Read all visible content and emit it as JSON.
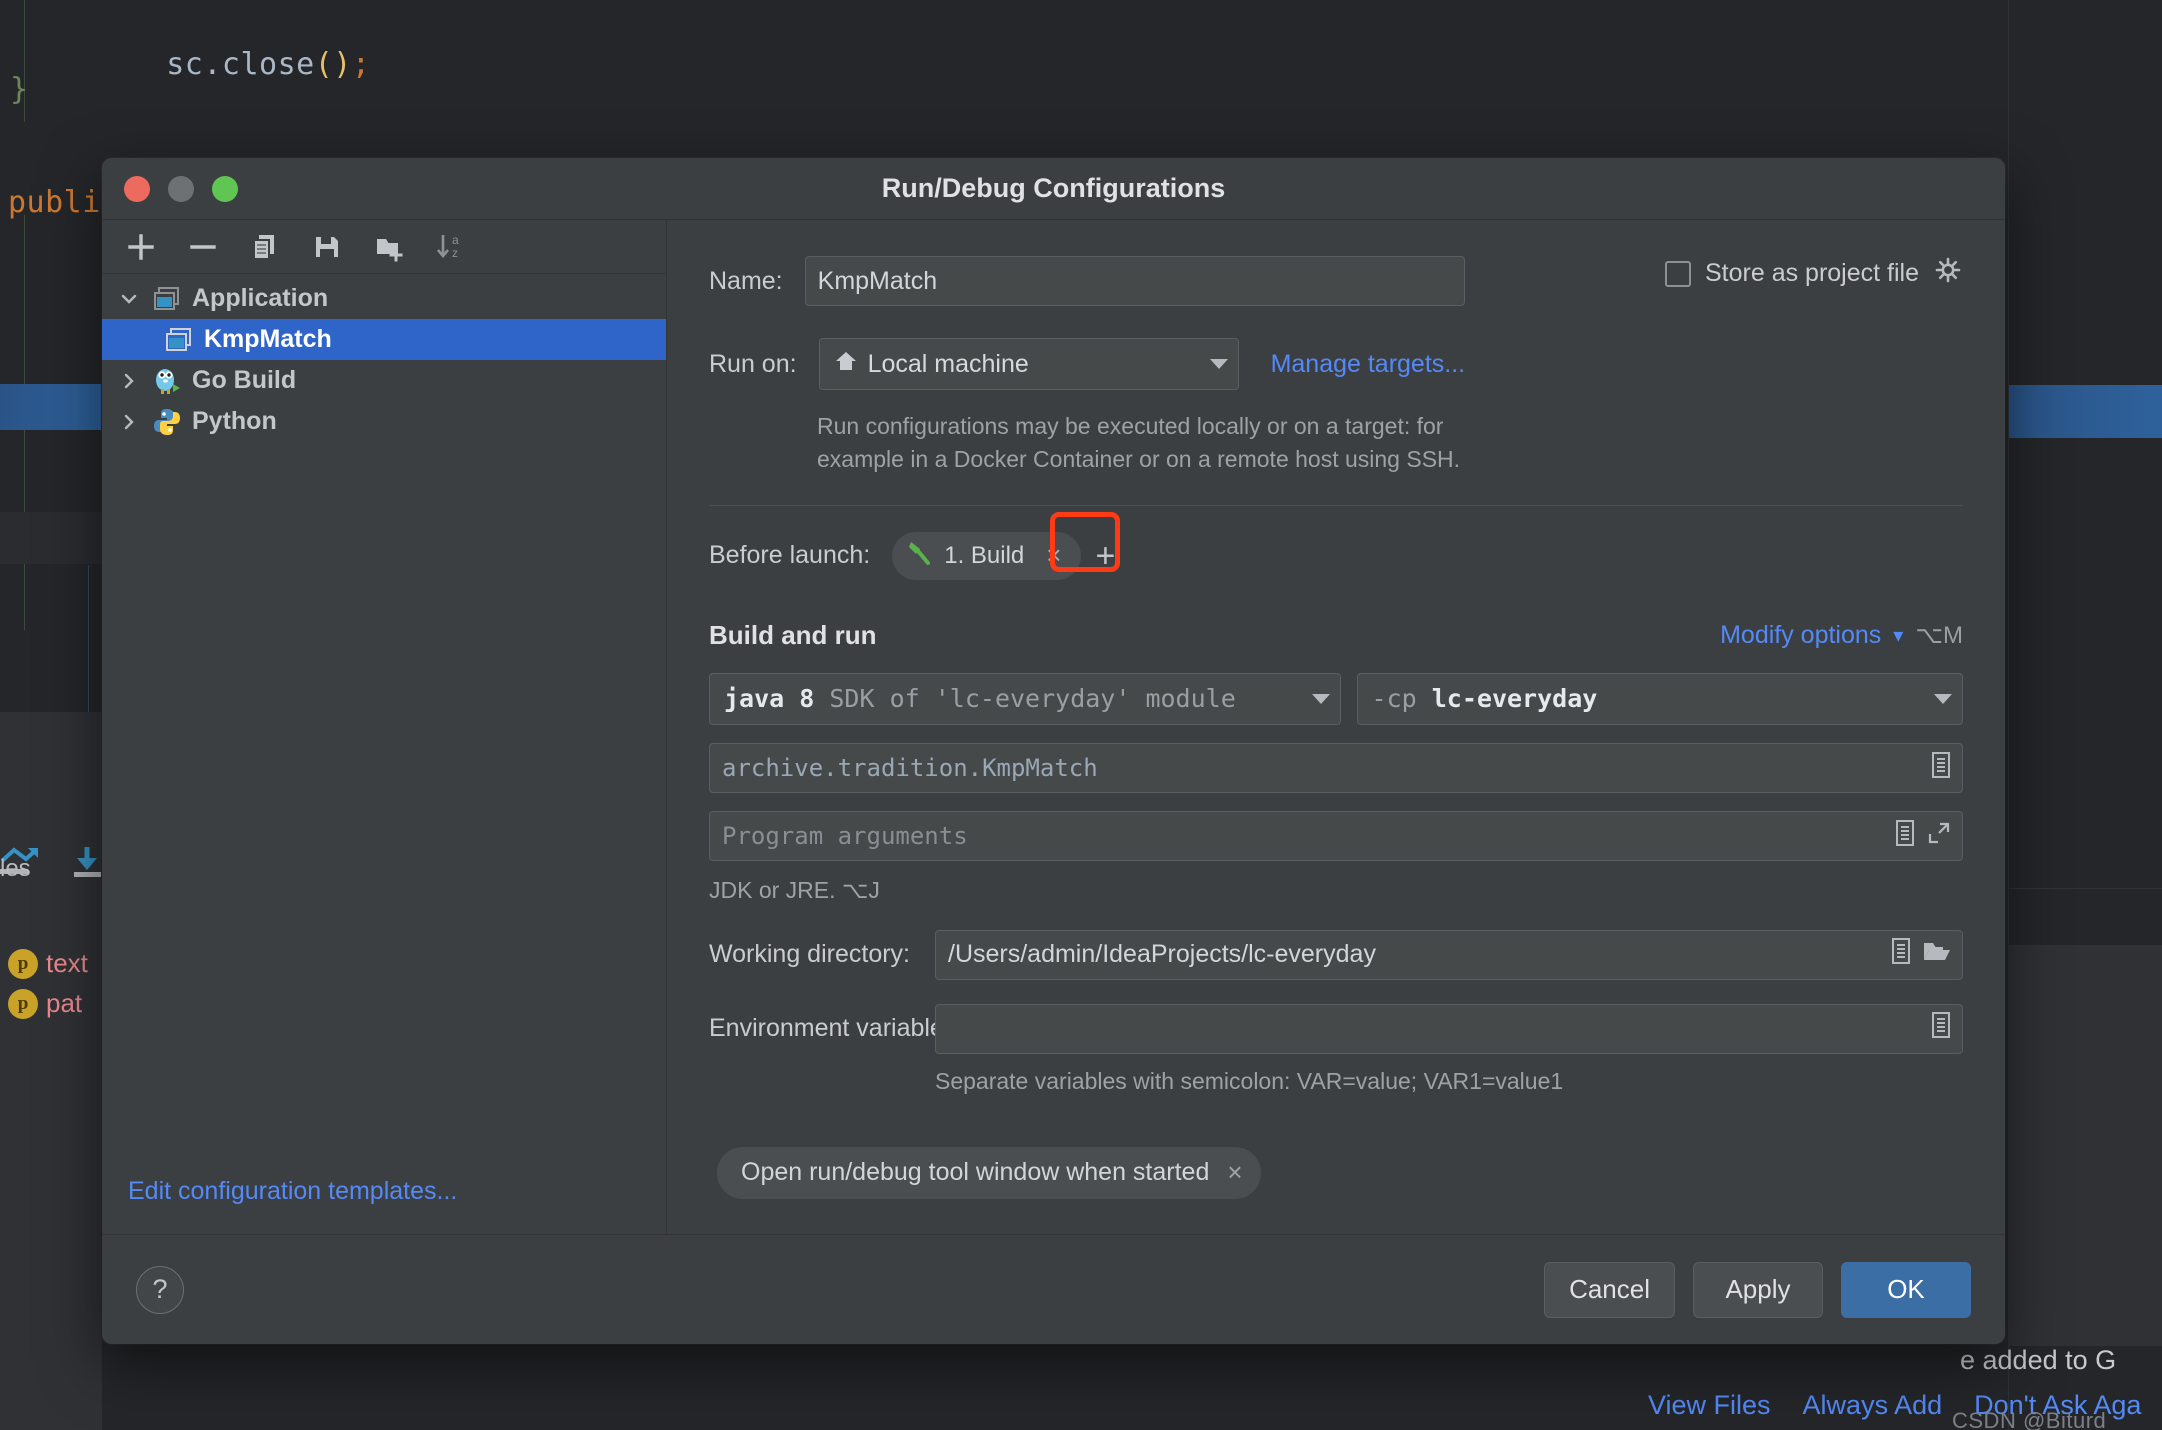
{
  "background": {
    "code_lines": [
      {
        "text": "sc.close();",
        "kind": "call"
      },
      {
        "text": "}",
        "kind": "brace"
      },
      {
        "text": "publi",
        "kind": "keyword"
      }
    ],
    "variables_panel": {
      "title": "les",
      "items": [
        {
          "badge": "p",
          "name": "text"
        },
        {
          "badge": "p",
          "name": "pat"
        }
      ]
    },
    "git_notification": {
      "text": "e added to G",
      "actions": [
        "View Files",
        "Always Add",
        "Don't Ask Aga"
      ]
    },
    "watermark": "CSDN @Biturd"
  },
  "dialog": {
    "title": "Run/Debug Configurations",
    "window_controls": [
      "close",
      "minimize",
      "maximize"
    ],
    "tree_toolbar": [
      {
        "name": "add-icon",
        "label": "Add New Configuration"
      },
      {
        "name": "remove-icon",
        "label": "Remove Configuration"
      },
      {
        "name": "copy-icon",
        "label": "Copy Configuration"
      },
      {
        "name": "save-icon",
        "label": "Save Configuration"
      },
      {
        "name": "new-folder-icon",
        "label": "Create New Folder"
      },
      {
        "name": "sort-alphabetically-icon",
        "label": "Sort Configurations"
      }
    ],
    "tree": [
      {
        "label": "Application",
        "level": 0,
        "expanded": true,
        "icon": "application-icon",
        "selected": false
      },
      {
        "label": "KmpMatch",
        "level": 1,
        "expanded": null,
        "icon": "application-icon",
        "selected": true
      },
      {
        "label": "Go Build",
        "level": 0,
        "expanded": false,
        "icon": "go-gopher-icon",
        "selected": false
      },
      {
        "label": "Python",
        "level": 0,
        "expanded": false,
        "icon": "python-icon",
        "selected": false
      }
    ],
    "edit_templates_link": "Edit configuration templates...",
    "form": {
      "name_label": "Name:",
      "name_value": "KmpMatch",
      "store_as_project_file_label": "Store as project file",
      "store_as_project_file_checked": false,
      "run_on_label": "Run on:",
      "run_on_value": "Local machine",
      "manage_targets_link": "Manage targets...",
      "run_on_hint_line1": "Run configurations may be executed locally or on a target: for",
      "run_on_hint_line2": "example in a Docker Container or on a remote host using SSH.",
      "before_launch_label": "Before launch:",
      "before_launch_chip": "1. Build",
      "before_launch_add": "+",
      "build_and_run_title": "Build and run",
      "modify_options_link": "Modify options",
      "modify_options_shortcut": "⌥M",
      "sdk_prefix": "java 8",
      "sdk_suffix": "SDK of 'lc-everyday' module",
      "classpath_prefix": "-cp",
      "classpath_value": "lc-everyday",
      "main_class": "archive.tradition.KmpMatch",
      "program_arguments_placeholder": "Program arguments",
      "program_arguments_value": "",
      "jdk_hint": "JDK or JRE. ⌥J",
      "working_directory_label": "Working directory:",
      "working_directory_value": "/Users/admin/IdeaProjects/lc-everyday",
      "environment_variables_label": "Environment variables:",
      "environment_variables_value": "",
      "environment_hint": "Separate variables with semicolon: VAR=value; VAR1=value1",
      "tool_window_chip": "Open run/debug tool window when started"
    },
    "footer": {
      "help_label": "?",
      "cancel_label": "Cancel",
      "apply_label": "Apply",
      "ok_label": "OK"
    }
  },
  "colors": {
    "accent_blue": "#548af7",
    "selection_blue": "#2f65c9",
    "primary_button": "#3a6ea5",
    "highlight_red": "#ff3b16",
    "dialog_bg": "#3c3f41",
    "field_bg": "#45494a"
  }
}
